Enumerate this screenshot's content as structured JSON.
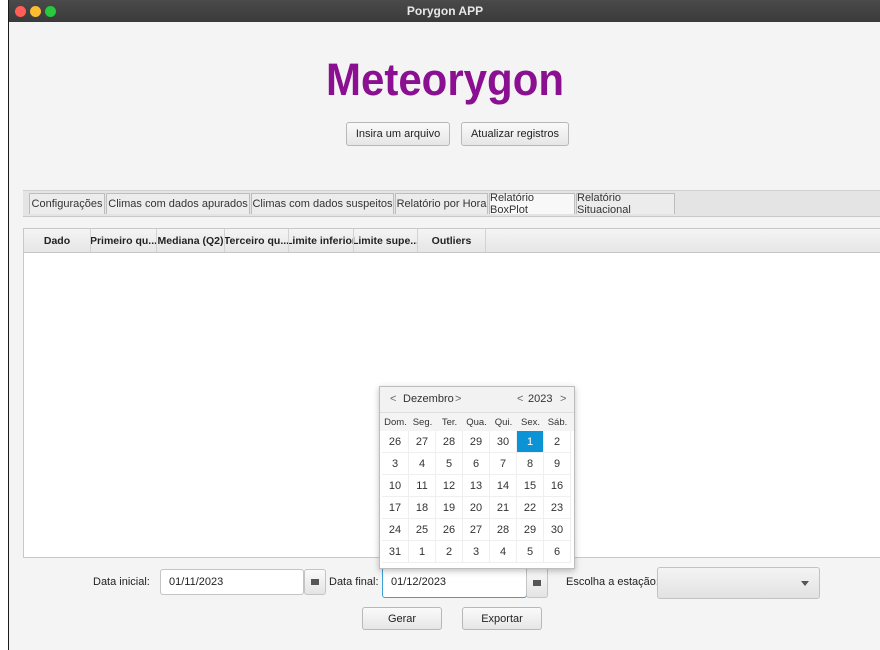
{
  "window": {
    "title": "Porygon APP"
  },
  "app": {
    "heading": "Meteorygon"
  },
  "actions": {
    "insert_file": "Insira um arquivo",
    "update_records": "Atualizar registros"
  },
  "tabs": [
    "Configurações",
    "Climas com dados apurados",
    "Climas com dados suspeitos",
    "Relatório por Hora",
    "Relatório BoxPlot",
    "Relatório Situacional"
  ],
  "active_tab": "Relatório BoxPlot",
  "table": {
    "columns": [
      "Dado",
      "Primeiro qu...",
      "Mediana (Q2)",
      "Terceiro qu...",
      "Limite inferior",
      "Limite supe...",
      "Outliers"
    ],
    "rows": []
  },
  "filters": {
    "start_label": "Data inicial:",
    "start_value": "01/11/2023",
    "end_label": "Data final:",
    "end_value": "01/12/2023",
    "station_label": "Escolha a estação:",
    "station_value": ""
  },
  "buttons": {
    "generate": "Gerar",
    "export": "Exportar"
  },
  "date_picker": {
    "month": "Dezembro",
    "year": "2023",
    "prev": "<",
    "next": ">",
    "weekdays": [
      "Dom.",
      "Seg.",
      "Ter.",
      "Qua.",
      "Qui.",
      "Sex.",
      "Sáb."
    ],
    "weeks": [
      [
        "26",
        "27",
        "28",
        "29",
        "30",
        "1",
        "2"
      ],
      [
        "3",
        "4",
        "5",
        "6",
        "7",
        "8",
        "9"
      ],
      [
        "10",
        "11",
        "12",
        "13",
        "14",
        "15",
        "16"
      ],
      [
        "17",
        "18",
        "19",
        "20",
        "21",
        "22",
        "23"
      ],
      [
        "24",
        "25",
        "26",
        "27",
        "28",
        "29",
        "30"
      ],
      [
        "31",
        "1",
        "2",
        "3",
        "4",
        "5",
        "6"
      ]
    ],
    "selected": "1"
  },
  "colors": {
    "heading": "#8a0f91",
    "accent": "#0c93d6"
  }
}
